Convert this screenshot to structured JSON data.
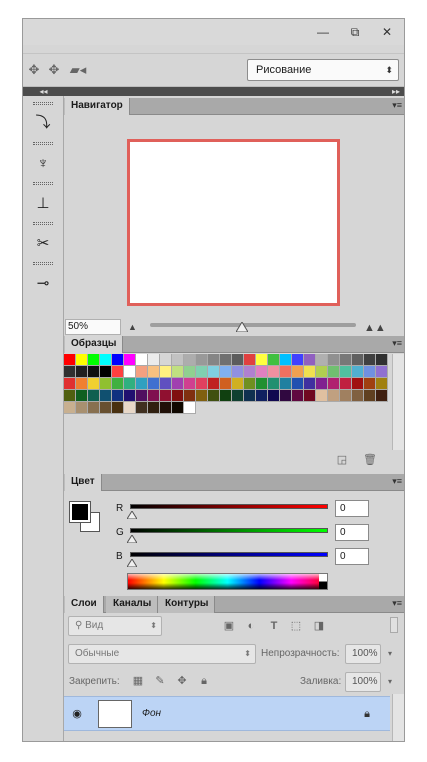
{
  "window": {
    "minimize": "—",
    "restore": "⧉",
    "close": "✕"
  },
  "options": {
    "workspace": "Рисование",
    "icons": [
      "move-arrows-icon",
      "move-arrows-icon",
      "video-camera-icon"
    ]
  },
  "navigator": {
    "tab": "Навигатор",
    "zoom": "50%"
  },
  "swatches": {
    "tab": "Образцы",
    "colors": [
      "#ff0000",
      "#ffff00",
      "#00ff00",
      "#00ffff",
      "#0000ff",
      "#ff00ff",
      "#ffffff",
      "#ebebeb",
      "#d6d6d6",
      "#c2c2c2",
      "#adadad",
      "#999999",
      "#858585",
      "#707070",
      "#5c5c5c",
      "#e04040",
      "#ffff40",
      "#40c040",
      "#00c0ff",
      "#4040ff",
      "#9060c0",
      "#b0b0b0",
      "#909090",
      "#787878",
      "#606060",
      "#404040",
      "#303030",
      "#303030",
      "#202020",
      "#101010",
      "#000000",
      "#ff4040",
      "#ffffff",
      "#f4a080",
      "#f8c080",
      "#fff080",
      "#c0e080",
      "#90d090",
      "#80d0b0",
      "#80d0e0",
      "#80b0f0",
      "#9090e0",
      "#b080d0",
      "#e080c0",
      "#f090a0",
      "#f07060",
      "#f0a050",
      "#f0e050",
      "#b0d050",
      "#70c070",
      "#50c0a0",
      "#50b0d0",
      "#7090e0",
      "#9070d0",
      "#e03030",
      "#f08030",
      "#f0d030",
      "#90c030",
      "#40b040",
      "#30b080",
      "#30a0c0",
      "#4070d0",
      "#6050c0",
      "#a040b0",
      "#d04090",
      "#e04060",
      "#c02020",
      "#d06020",
      "#d0b020",
      "#709020",
      "#209030",
      "#209070",
      "#2080a0",
      "#2050b0",
      "#4030a0",
      "#802090",
      "#b02070",
      "#c02040",
      "#a01010",
      "#a04010",
      "#a08010",
      "#506010",
      "#106020",
      "#106050",
      "#105070",
      "#103080",
      "#201070",
      "#501060",
      "#801050",
      "#901030",
      "#801010",
      "#803010",
      "#806010",
      "#405010",
      "#104010",
      "#104030",
      "#103050",
      "#102060",
      "#100850",
      "#300840",
      "#600840",
      "#700820",
      "#e0c0a0",
      "#c0a080",
      "#a08060",
      "#806040",
      "#604020",
      "#402010",
      "#c8b090",
      "#a89070",
      "#887050",
      "#685030",
      "#483010",
      "#e8d8c8",
      "#403020",
      "#302010",
      "#201008",
      "#100800",
      "#ffffff"
    ]
  },
  "color": {
    "tab": "Цвет",
    "channels": [
      {
        "label": "R",
        "value": "0"
      },
      {
        "label": "G",
        "value": "0"
      },
      {
        "label": "B",
        "value": "0"
      }
    ]
  },
  "layers": {
    "tabs": [
      "Слои",
      "Каналы",
      "Контуры"
    ],
    "filter_placeholder": "Вид",
    "blend_mode": "Обычные",
    "opacity_label": "Непрозрачность:",
    "opacity": "100%",
    "lock_label": "Закрепить:",
    "fill_label": "Заливка:",
    "fill": "100%",
    "layer_name": "Фон"
  }
}
